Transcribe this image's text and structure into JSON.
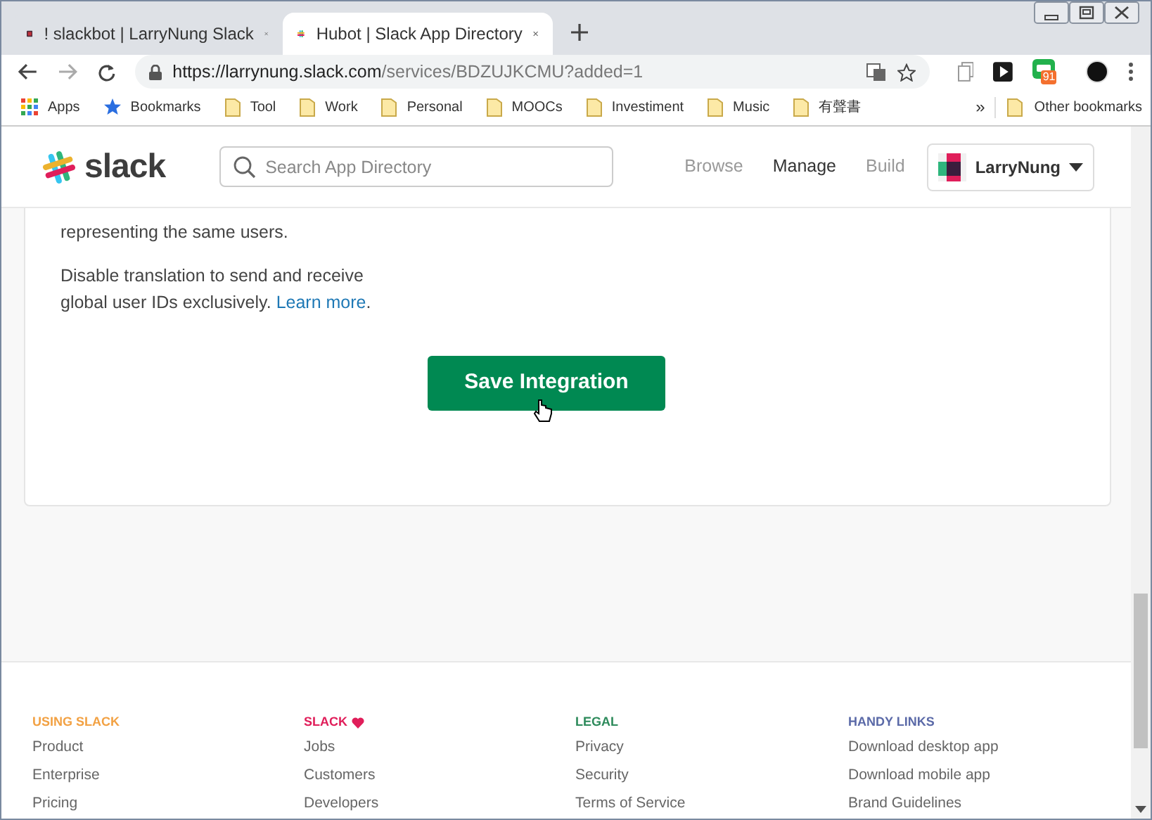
{
  "tabs": [
    {
      "title": "! slackbot | LarryNung Slack",
      "selected": false
    },
    {
      "title": "Hubot | Slack App Directory",
      "selected": true
    }
  ],
  "address_bar": {
    "host": "https://larrynung.slack.com",
    "path": "/services/BDZUJKCMU?added=1"
  },
  "extension_badge": "91",
  "bookmarks": [
    {
      "kind": "apps",
      "label": "Apps"
    },
    {
      "kind": "star",
      "label": "Bookmarks"
    },
    {
      "kind": "folder",
      "label": "Tool"
    },
    {
      "kind": "folder",
      "label": "Work"
    },
    {
      "kind": "folder",
      "label": "Personal"
    },
    {
      "kind": "folder",
      "label": "MOOCs"
    },
    {
      "kind": "folder",
      "label": "Investiment"
    },
    {
      "kind": "folder",
      "label": "Music"
    },
    {
      "kind": "folder",
      "label": "有聲書"
    }
  ],
  "bookmarks_overflow": "»",
  "other_bookmarks": "Other bookmarks",
  "header": {
    "logo_text": "slack",
    "search_placeholder": "Search App Directory",
    "nav": [
      {
        "label": "Browse",
        "selected": false
      },
      {
        "label": "Manage",
        "selected": true
      },
      {
        "label": "Build",
        "selected": false
      }
    ],
    "user": "LarryNung"
  },
  "content": {
    "paragraph_1": "representing the same users.",
    "paragraph_2": "Disable translation to send and receive global user IDs exclusively.",
    "link": "Learn more",
    "after_link": ".",
    "button": "Save Integration"
  },
  "footer": [
    {
      "heading": "USING SLACK",
      "color": "#f2a143",
      "heart": false,
      "links": [
        "Product",
        "Enterprise",
        "Pricing"
      ]
    },
    {
      "heading": "SLACK",
      "color": "#e01e5a",
      "heart": true,
      "links": [
        "Jobs",
        "Customers",
        "Developers"
      ]
    },
    {
      "heading": "LEGAL",
      "color": "#2d8a5b",
      "heart": false,
      "links": [
        "Privacy",
        "Security",
        "Terms of Service"
      ]
    },
    {
      "heading": "HANDY LINKS",
      "color": "#5b6aa8",
      "heart": false,
      "links": [
        "Download desktop app",
        "Download mobile app",
        "Brand Guidelines"
      ]
    }
  ]
}
